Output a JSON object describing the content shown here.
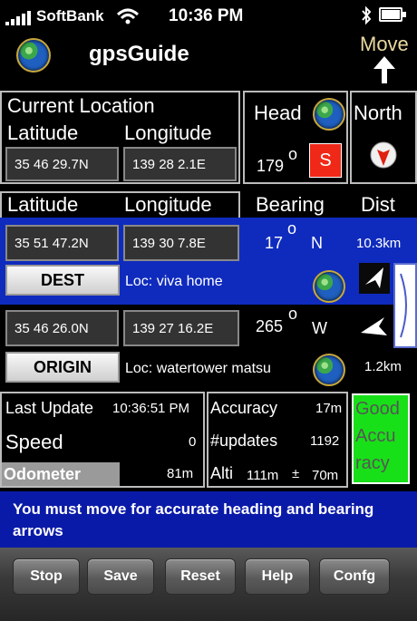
{
  "status": {
    "carrier": "SoftBank",
    "time": "10:36 PM"
  },
  "app": {
    "title": "gpsGuide",
    "move_label": "Move"
  },
  "current": {
    "header": "Current Location",
    "lat_label": "Latitude",
    "lon_label": "Longitude",
    "lat": "35 46 29.7N",
    "lon": "139 28 2.1E",
    "head_label": "Head",
    "north_label": "North",
    "heading_value": "179",
    "degree_symbol": "o",
    "heading_dir": "S"
  },
  "targets": {
    "lat_label": "Latitude",
    "lon_label": "Longitude",
    "bearing_label": "Bearing",
    "dist_label": "Dist",
    "dest": {
      "lat": "35 51 47.2N",
      "lon": "139 30 7.8E",
      "bearing": "17",
      "dir": "N",
      "dist": "10.3km",
      "button": "DEST",
      "loc": "Loc:  viva home"
    },
    "origin": {
      "lat": "35 46 26.0N",
      "lon": "139 27 16.2E",
      "bearing": "265",
      "dir": "W",
      "dist": "1.2km",
      "button": "ORIGIN",
      "loc": "Loc:  watertower matsu"
    }
  },
  "stats": {
    "last_update_label": "Last Update",
    "last_update_value": "10:36:51 PM",
    "speed_label": "Speed",
    "speed_value": "0",
    "odometer_label": "Odometer",
    "odometer_value": "81m",
    "accuracy_label": "Accuracy",
    "accuracy_value": "17m",
    "updates_label": "#updates",
    "updates_value": "1192",
    "alti_label": "Alti",
    "alti_value": "111m",
    "alti_pm": "±",
    "alti_err": "70m",
    "quality_line1": "Good",
    "quality_line2": "Accu",
    "quality_line3": "racy"
  },
  "message": "You must move for accurate heading and bearing arrows",
  "toolbar": {
    "stop": "Stop",
    "save": "Save",
    "reset": "Reset",
    "help": "Help",
    "config": "Confg"
  },
  "colors": {
    "blue": "#0f2bbd",
    "red": "#f02818",
    "green": "#18e018",
    "banner": "#0a1aa8"
  }
}
